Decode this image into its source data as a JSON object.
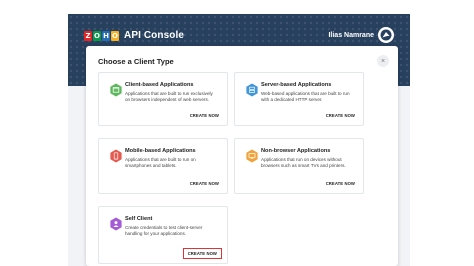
{
  "header": {
    "logo_letters": [
      "Z",
      "O",
      "H",
      "O"
    ],
    "logo_colors": [
      "#e42527",
      "#089949",
      "#226db4",
      "#f9b21d"
    ],
    "title": "API Console",
    "user_name": "Ilias Namrane"
  },
  "dialog": {
    "title": "Choose a Client Type",
    "close_label": "×"
  },
  "cards": [
    {
      "title": "Client-based Applications",
      "description": "Applications that are built to run exclusively on browsers independent of web servers.",
      "cta": "CREATE NOW",
      "icon": "browser-icon",
      "icon_color": "#5cb85c"
    },
    {
      "title": "Server-based Applications",
      "description": "Web-based applications that are built to run with a dedicated HTTP server.",
      "cta": "CREATE NOW",
      "icon": "server-icon",
      "icon_color": "#3f96d8"
    },
    {
      "title": "Mobile-based Applications",
      "description": "Applications that are built to run on smartphones and tablets.",
      "cta": "CREATE NOW",
      "icon": "mobile-icon",
      "icon_color": "#e55a4e"
    },
    {
      "title": "Non-browser Applications",
      "description": "Applications that run on devices without browsers such as smart TVs and printers.",
      "cta": "CREATE NOW",
      "icon": "device-icon",
      "icon_color": "#f0a23b"
    },
    {
      "title": "Self Client",
      "description": "Create credentials to test client-server handling for your applications.",
      "cta": "CREATE NOW",
      "icon": "self-client-icon",
      "icon_color": "#a55bd6",
      "cta_highlight_color": "#d9353a"
    }
  ]
}
